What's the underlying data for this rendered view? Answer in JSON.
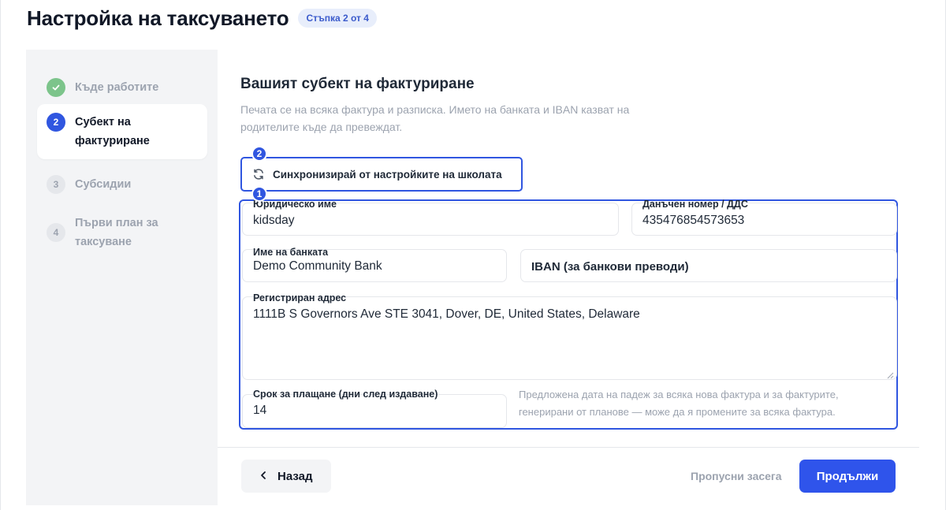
{
  "header": {
    "title": "Настройка на таксуването",
    "step_badge": "Стъпка 2 от 4"
  },
  "sidebar": {
    "steps": [
      {
        "number": "✓",
        "label": "Къде работите",
        "status": "done"
      },
      {
        "number": "2",
        "label": "Субект на фактуриране",
        "status": "current"
      },
      {
        "number": "3",
        "label": "Субсидии",
        "status": "todo"
      },
      {
        "number": "4",
        "label": "Първи план за таксуване",
        "status": "todo"
      }
    ]
  },
  "main": {
    "title": "Вашият субект на фактуриране",
    "description": "Печата се на всяка фактура и разписка. Името на банката и IBAN казват на родителите къде да превеждат.",
    "sync_button": "Синхронизирай от настройките на школата",
    "markers": [
      "1",
      "2"
    ],
    "fields": {
      "legal_name": {
        "label": "Юридическо име",
        "value": "kidsday"
      },
      "tax_number": {
        "label": "Данъчен номер / ДДС",
        "value": "435476854573653"
      },
      "bank_name": {
        "label": "Име на банката",
        "value": "Demo Community Bank"
      },
      "iban": {
        "label": "",
        "placeholder": "IBAN (за банкови преводи)"
      },
      "address": {
        "label": "Регистриран адрес",
        "value": "1111B S Governors Ave STE 3041, Dover, DE, United States, Delaware"
      },
      "payment_terms": {
        "label": "Срок за плащане (дни след издаване)",
        "value": "14"
      }
    },
    "payment_hint": "Предложена дата на падеж за всяка нова фактура и за фактурите, генерирани от планове — може да я промените за всяка фактура."
  },
  "footer": {
    "back": "Назад",
    "skip": "Пропусни засега",
    "next": "Продължи"
  },
  "colors": {
    "accent": "#3056e0",
    "primary_button": "#2f54eb",
    "done": "#7cc48b",
    "muted_text": "#9ca3af",
    "sidebar_bg": "#f3f4f6"
  },
  "icons": [
    "check-icon",
    "sync-icon",
    "chevron-left-icon",
    "resize-grip-icon"
  ]
}
